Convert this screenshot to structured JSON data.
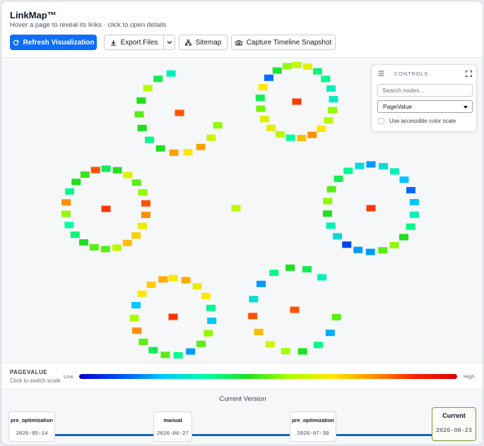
{
  "app": {
    "title": "LinkMap™",
    "subtitle": "Hover a page to reveal its links · click to open details"
  },
  "toolbar": {
    "refresh_label": "Refresh Visualization",
    "export_label": "Export Files",
    "sitemap_label": "Sitemap",
    "snapshot_label": "Capture Timeline Snapshot",
    "accent": "#0d6efd"
  },
  "controls": {
    "title": "CONTROLS",
    "search_placeholder": "Search nodes...",
    "metric_selected": "PageValue",
    "accessible_label": "Use accessible color scale",
    "accessible_checked": false
  },
  "legend": {
    "title": "PAGEVALUE",
    "hint": "Click to switch scale",
    "low": "Low",
    "high": "High"
  },
  "timeline": {
    "heading": "Current Version",
    "versions": [
      {
        "name": "pre_optimization",
        "date": "2026-05-14"
      },
      {
        "name": "manual",
        "date": "2026-06-27"
      },
      {
        "name": "pre_optimization",
        "date": "2026-07-30"
      },
      {
        "name": "Current",
        "date": "2026-08-23"
      }
    ]
  },
  "graph": {
    "metric": "PageValue",
    "clusters": [
      {
        "name": "cluster-top-left",
        "hub": 0.9,
        "nodes": [
          0.6,
          0.67,
          0.83,
          0.75,
          0.83,
          0.5,
          0.4,
          0.5,
          0.55,
          0.5,
          0.65,
          0.45,
          0.35
        ]
      },
      {
        "name": "cluster-top-right",
        "hub": 0.92,
        "nodes": [
          0.65,
          0.7,
          0.42,
          0.4,
          0.35,
          0.33,
          0.6,
          0.64,
          0.75,
          0.85,
          0.8,
          0.38,
          0.65,
          0.7,
          0.7,
          0.58,
          0.45,
          0.75,
          0.15,
          0.48,
          0.6
        ]
      },
      {
        "name": "cluster-mid-left",
        "hub": 0.92,
        "nodes": [
          0.45,
          0.5,
          0.7,
          0.55,
          0.6,
          0.9,
          0.85,
          0.72,
          0.78,
          0.8,
          0.65,
          0.55,
          0.55,
          0.5,
          0.42,
          0.38,
          0.6,
          0.85,
          0.4,
          0.5,
          0.52,
          0.9
        ]
      },
      {
        "name": "cluster-mid-right",
        "hub": 0.92,
        "nodes": [
          0.2,
          0.3,
          0.35,
          0.25,
          0.15,
          0.25,
          0.35,
          0.4,
          0.5,
          0.6,
          0.55,
          0.2,
          0.2,
          0.1,
          0.3,
          0.35,
          0.5,
          0.6,
          0.55,
          0.45,
          0.4,
          0.3
        ]
      },
      {
        "name": "cluster-bottom-left",
        "hub": 0.92,
        "nodes": [
          0.75,
          0.82,
          0.72,
          0.75,
          0.4,
          0.25,
          0.6,
          0.55,
          0.2,
          0.4,
          0.55,
          0.45,
          0.55,
          0.85,
          0.62,
          0.25,
          0.75,
          0.78,
          0.82
        ]
      },
      {
        "name": "cluster-bottom-right",
        "hub": 0.9,
        "nodes": [
          0.55,
          0.22,
          0.4,
          0.5,
          0.62,
          0.68,
          0.8,
          0.9,
          0.3,
          0.2,
          0.4,
          0.5,
          0.45,
          0.35
        ]
      },
      {
        "name": "orphan",
        "hub": 0.65,
        "nodes": []
      }
    ]
  }
}
